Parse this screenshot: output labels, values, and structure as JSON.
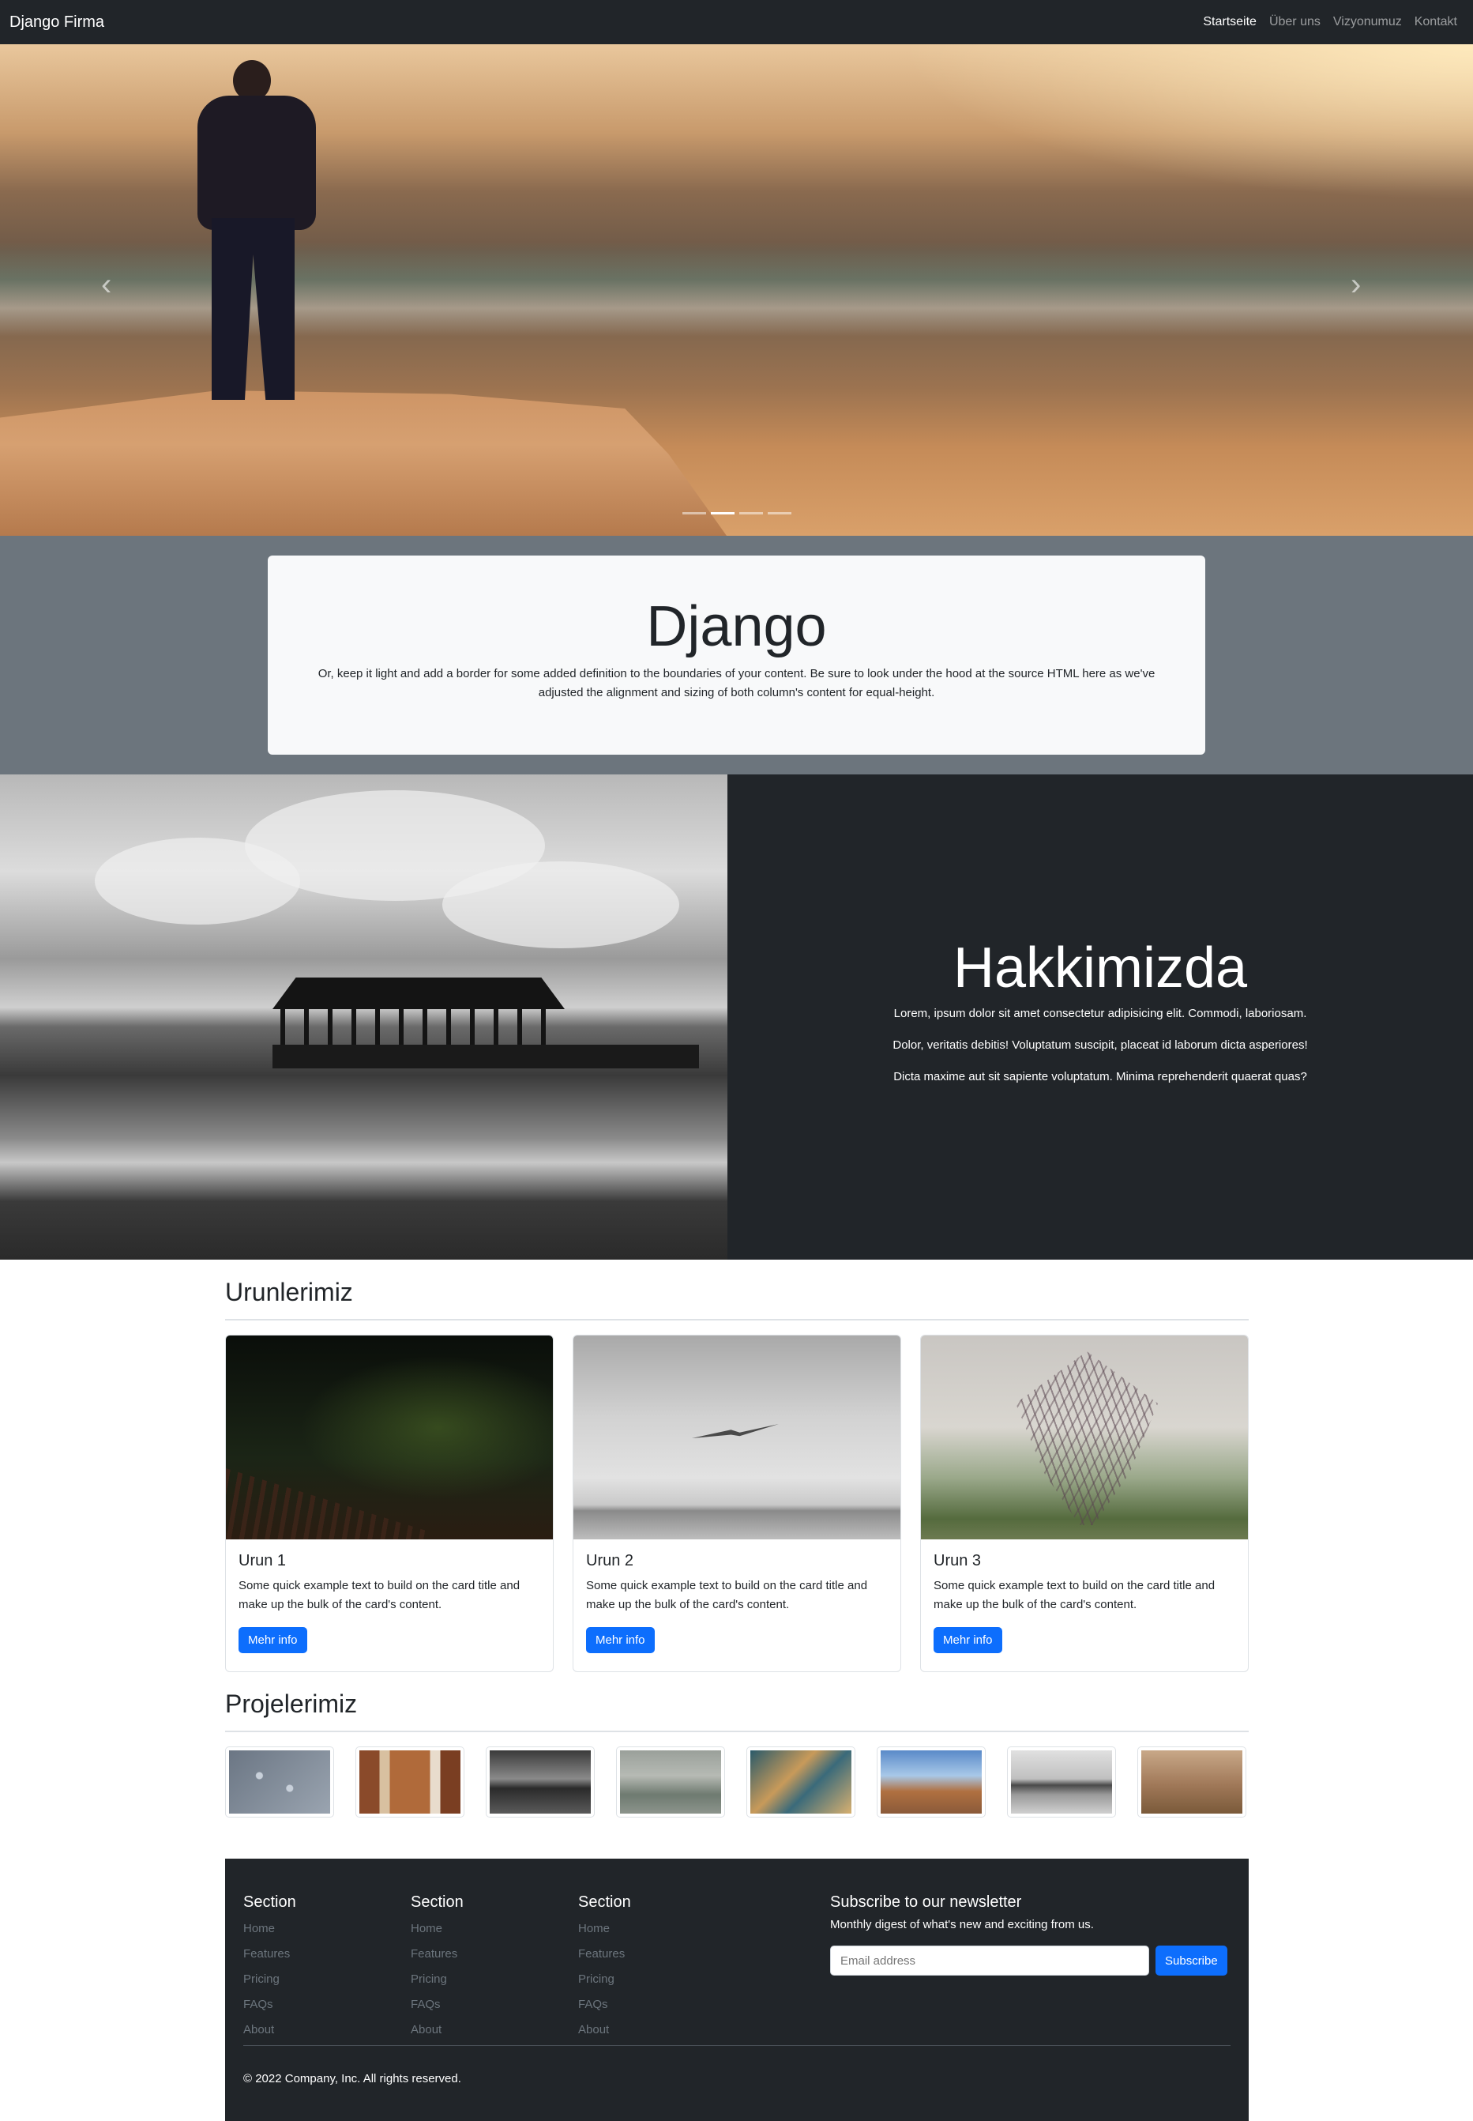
{
  "nav": {
    "brand": "Django Firma",
    "links": [
      {
        "label": "Startseite",
        "active": true
      },
      {
        "label": "Über uns",
        "active": false
      },
      {
        "label": "Vizyonumuz",
        "active": false
      },
      {
        "label": "Kontakt",
        "active": false
      }
    ]
  },
  "carousel": {
    "prev_icon": "chevron-left-icon",
    "next_icon": "chevron-right-icon",
    "prev_glyph": "‹",
    "next_glyph": "›",
    "slide_count": 4,
    "active_slide": 2
  },
  "jumbotron": {
    "title": "Django",
    "text": "Or, keep it light and add a border for some added definition to the boundaries of your content. Be sure to look under the hood at the source HTML here as we've adjusted the alignment and sizing of both column's content for equal-height."
  },
  "about": {
    "title": "Hakkimizda",
    "lines": [
      "Lorem, ipsum dolor sit amet consectetur adipisicing elit. Commodi, laboriosam.",
      "Dolor, veritatis debitis! Voluptatum suscipit, placeat id laborum dicta asperiores!",
      "Dicta maxime aut sit sapiente voluptatum. Minima reprehenderit quaerat quas?"
    ]
  },
  "products": {
    "heading": "Urunlerimiz",
    "cards": [
      {
        "title": "Urun 1",
        "text": "Some quick example text to build on the card title and make up the bulk of the card's content.",
        "button": "Mehr info"
      },
      {
        "title": "Urun 2",
        "text": "Some quick example text to build on the card title and make up the bulk of the card's content.",
        "button": "Mehr info"
      },
      {
        "title": "Urun 3",
        "text": "Some quick example text to build on the card title and make up the bulk of the card's content.",
        "button": "Mehr info"
      }
    ]
  },
  "projects": {
    "heading": "Projelerimiz",
    "thumbnail_count": 8
  },
  "footer": {
    "columns": [
      {
        "heading": "Section",
        "links": [
          "Home",
          "Features",
          "Pricing",
          "FAQs",
          "About"
        ]
      },
      {
        "heading": "Section",
        "links": [
          "Home",
          "Features",
          "Pricing",
          "FAQs",
          "About"
        ]
      },
      {
        "heading": "Section",
        "links": [
          "Home",
          "Features",
          "Pricing",
          "FAQs",
          "About"
        ]
      }
    ],
    "newsletter": {
      "heading": "Subscribe to our newsletter",
      "text": "Monthly digest of what's new and exciting from us.",
      "placeholder": "Email address",
      "button": "Subscribe"
    },
    "copyright": "© 2022 Company, Inc. All rights reserved."
  },
  "colors": {
    "navbar_bg": "#212529",
    "primary": "#0d6efd",
    "gray_band": "#6c757d",
    "light": "#f8f9fa"
  }
}
